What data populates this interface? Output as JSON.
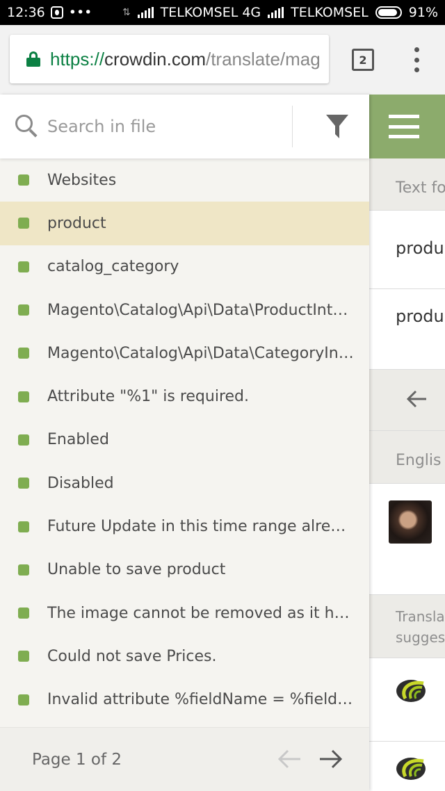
{
  "status_bar": {
    "time": "12:36",
    "dots": "•••",
    "carrier1": "TELKOMSEL 4G",
    "carrier2": "TELKOMSEL",
    "battery": "91%",
    "battery_level": 0.91
  },
  "browser": {
    "url_scheme": "https://",
    "url_host": "crowdin.com",
    "url_path": "/translate/mag",
    "tab_count": "2"
  },
  "search": {
    "placeholder": "Search in file"
  },
  "file_list": [
    "Websites",
    "product",
    "catalog_category",
    "Magento\\Catalog\\Api\\Data\\ProductInte...",
    "Magento\\Catalog\\Api\\Data\\CategoryInt...",
    "Attribute \"%1\" is required.",
    "Enabled",
    "Disabled",
    "Future Update in this time range alread...",
    "Unable to save product",
    "The image cannot be removed as it has...",
    "Could not save Prices.",
    "Invalid attribute %fieldName = %fieldVa..."
  ],
  "selected_index": 1,
  "pager": {
    "label": "Page 1 of 2"
  },
  "right_panel": {
    "row1": "Text fo",
    "row2": "produ",
    "row3": "produ",
    "row5": "Englis",
    "row7_line1": "Transla",
    "row7_line2": "sugges"
  },
  "colors": {
    "accent_green": "#7fad51",
    "header_green": "#8cab6c",
    "selected_row": "#efe6c6",
    "url_green": "#0b8043"
  }
}
